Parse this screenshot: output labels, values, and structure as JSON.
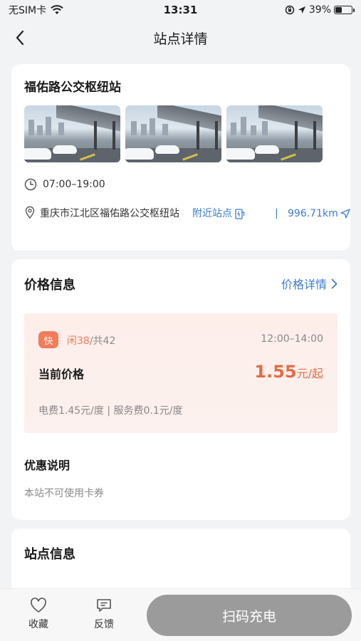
{
  "status_bar": {
    "carrier": "无SIM卡",
    "time": "13:31",
    "battery": "39%",
    "battery_level": 0.39
  },
  "nav": {
    "title": "站点详情",
    "back_icon": "chevron-left-icon"
  },
  "station": {
    "name": "福佑路公交枢纽站",
    "photo_count": 3,
    "hours": "07:00–19:00",
    "address": "重庆市江北区福佑路公交枢纽站",
    "nearby_label": "附近站点",
    "separator": "|",
    "distance": "996.71km"
  },
  "price": {
    "section_title": "价格信息",
    "detail_link": "价格详情",
    "badge": "快",
    "slots_free": "闲38",
    "slots_total": "/共42",
    "time_range": "12:00–14:00",
    "current_label": "当前价格",
    "current_value": "1.55",
    "current_unit": "元/起",
    "fee_breakdown": "电费1.45元/度 | 服务费0.1元/度",
    "promo_title": "优惠说明",
    "promo_text": "本站不可使用卡券"
  },
  "info": {
    "section_title": "站点信息"
  },
  "bottom_bar": {
    "favorite_label": "收藏",
    "feedback_label": "反馈",
    "scan_label": "扫码充电"
  },
  "colors": {
    "accent_blue": "#3b7bd1",
    "price_orange": "#e26c47",
    "badge_orange": "#f07c5a",
    "scan_button": "#9b9b9b"
  }
}
